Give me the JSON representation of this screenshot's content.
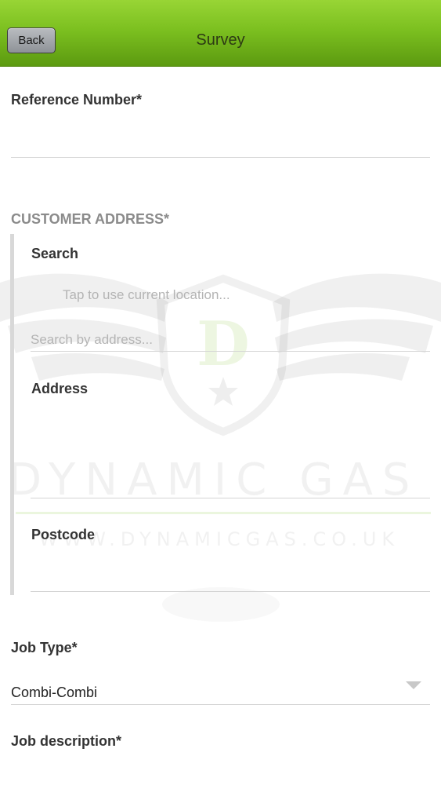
{
  "header": {
    "back_label": "Back",
    "title": "Survey"
  },
  "form": {
    "reference_number_label": "Reference Number*",
    "customer_address_heading": "CUSTOMER ADDRESS*",
    "search_label": "Search",
    "current_location_text": "Tap to use current location...",
    "search_placeholder": "Search by address...",
    "address_label": "Address",
    "postcode_label": "Postcode",
    "job_type_label": "Job Type*",
    "job_type_value": "Combi-Combi",
    "job_description_label": "Job description*"
  },
  "watermark": {
    "brand": "DYNAMIC GAS",
    "url": "WWW.DYNAMICGAS.CO.UK",
    "logo_letter": "D"
  },
  "colors": {
    "brand_green": "#7cc020",
    "label": "#333333",
    "section": "#8b8b8b"
  }
}
